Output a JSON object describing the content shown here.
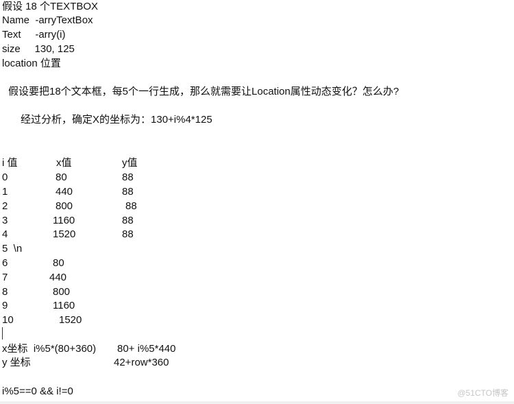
{
  "header_lines": [
    "假设 18 个TEXTBOX",
    "Name  -arryTextBox",
    "Text     -arry(i)",
    "size     130, 125",
    "location 位置"
  ],
  "question": "假设要把18个文本框，每5个一行生成，那么就需要让Location属性动态变化？怎么办?",
  "analysis": "经过分析，确定X的坐标为：130+i%4*125",
  "table": {
    "headers": [
      "i 值",
      "x值",
      "y值"
    ],
    "rows": [
      [
        "0",
        "80",
        "88"
      ],
      [
        "1",
        "440",
        "88"
      ],
      [
        "2",
        "800",
        "88"
      ],
      [
        "3",
        "1160",
        "88"
      ],
      [
        "4",
        "1520",
        "88"
      ],
      [
        "5  \\n",
        "",
        ""
      ],
      [
        "6",
        "80",
        ""
      ],
      [
        "7",
        "440",
        ""
      ],
      [
        "8",
        "800",
        ""
      ],
      [
        "9",
        "1160",
        ""
      ],
      [
        "10",
        "1520",
        ""
      ]
    ]
  },
  "formulas": {
    "x_label": "x坐标  i%5*(80+360)",
    "x_value": "80+ i%5*440",
    "y_label": "y 坐标",
    "y_value": "42+row*360",
    "condition": "i%5==0 && i!=0"
  },
  "watermark": "@51CTO博客"
}
